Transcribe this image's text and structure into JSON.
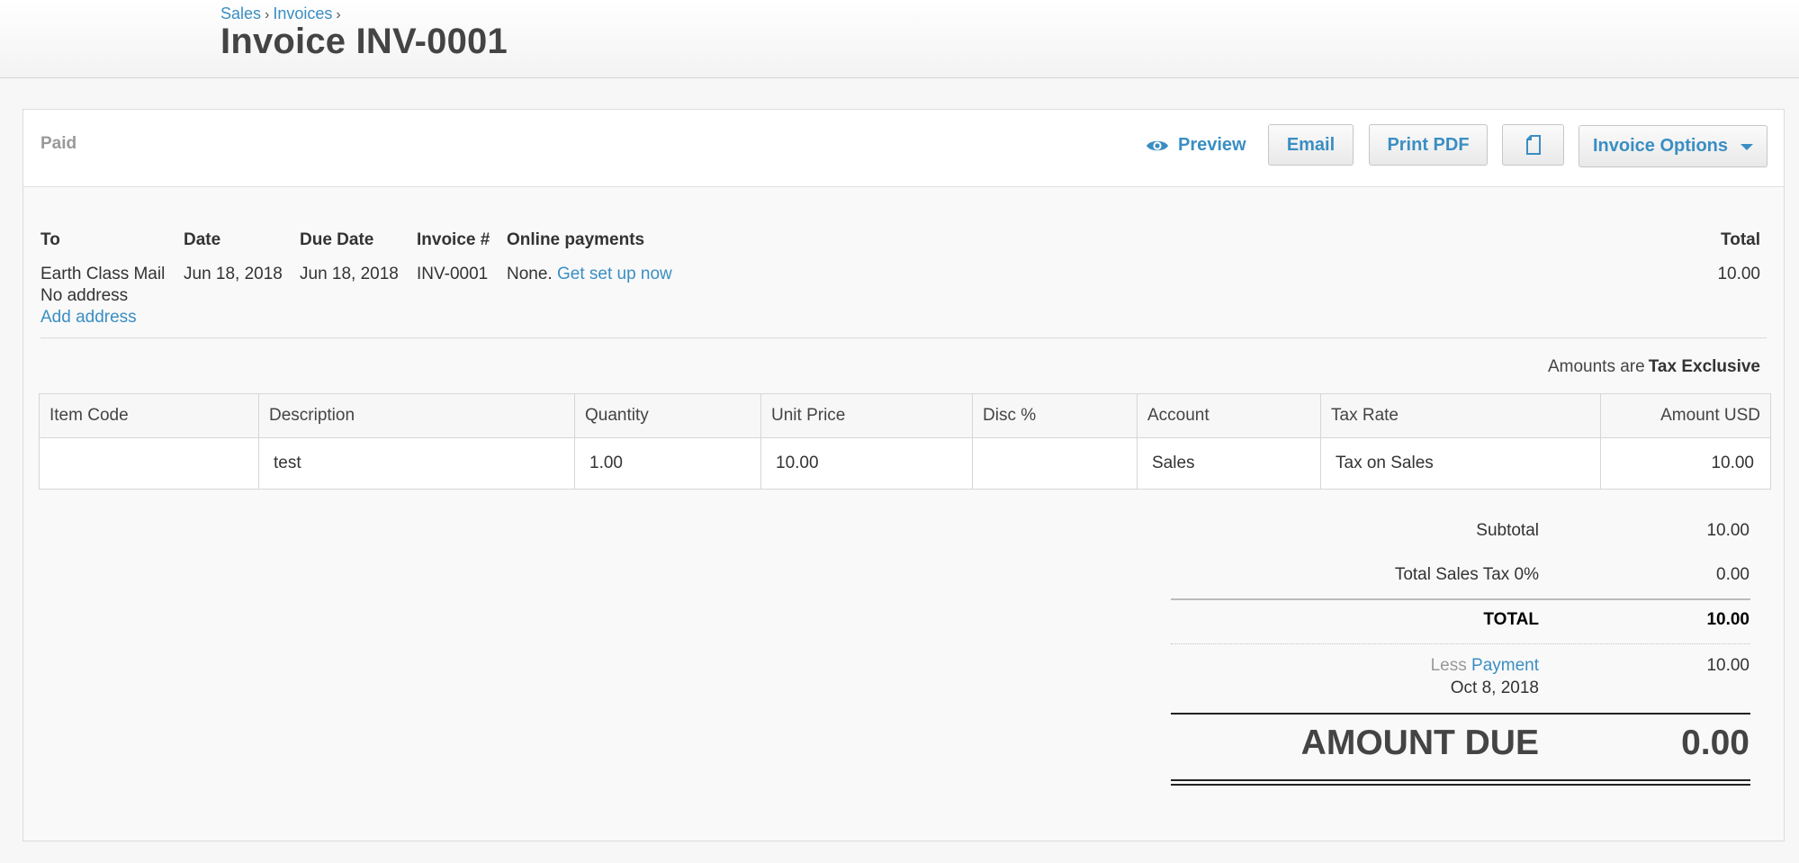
{
  "breadcrumb": {
    "items": [
      "Sales",
      "Invoices"
    ],
    "separator": "›"
  },
  "page_title": "Invoice INV-0001",
  "toolbar": {
    "status": "Paid",
    "preview_label": "Preview",
    "email_label": "Email",
    "print_label": "Print PDF",
    "copy_icon": "copy-icon",
    "options_label": "Invoice Options"
  },
  "info": {
    "headers": {
      "to": "To",
      "date": "Date",
      "due_date": "Due Date",
      "invoice_no": "Invoice #",
      "online_payments": "Online payments",
      "total": "Total"
    },
    "to_name": "Earth Class Mail",
    "no_address": "No address",
    "add_address": "Add address",
    "date": "Jun 18, 2018",
    "due_date": "Jun 18, 2018",
    "invoice_no": "INV-0001",
    "online_payments_prefix": "None.",
    "online_payments_link": "Get set up now",
    "total": "10.00"
  },
  "tax_mode": {
    "prefix": "Amounts are",
    "value": "Tax Exclusive"
  },
  "line_items": {
    "columns": [
      "Item Code",
      "Description",
      "Quantity",
      "Unit Price",
      "Disc %",
      "Account",
      "Tax Rate",
      "Amount USD"
    ],
    "rows": [
      {
        "item_code": "",
        "description": "test",
        "quantity": "1.00",
        "unit_price": "10.00",
        "disc": "",
        "account": "Sales",
        "tax_rate": "Tax on Sales",
        "amount": "10.00"
      }
    ]
  },
  "totals": {
    "subtotal_label": "Subtotal",
    "subtotal": "10.00",
    "tax_label": "Total Sales Tax 0%",
    "tax": "0.00",
    "total_label": "TOTAL",
    "total": "10.00",
    "less_label": "Less",
    "payment_link": "Payment",
    "payment_date": "Oct 8, 2018",
    "payment_amount": "10.00",
    "amount_due_label": "AMOUNT DUE",
    "amount_due": "0.00"
  },
  "colors": {
    "link": "#3a8ec3",
    "title": "#444444",
    "muted": "#999999"
  }
}
